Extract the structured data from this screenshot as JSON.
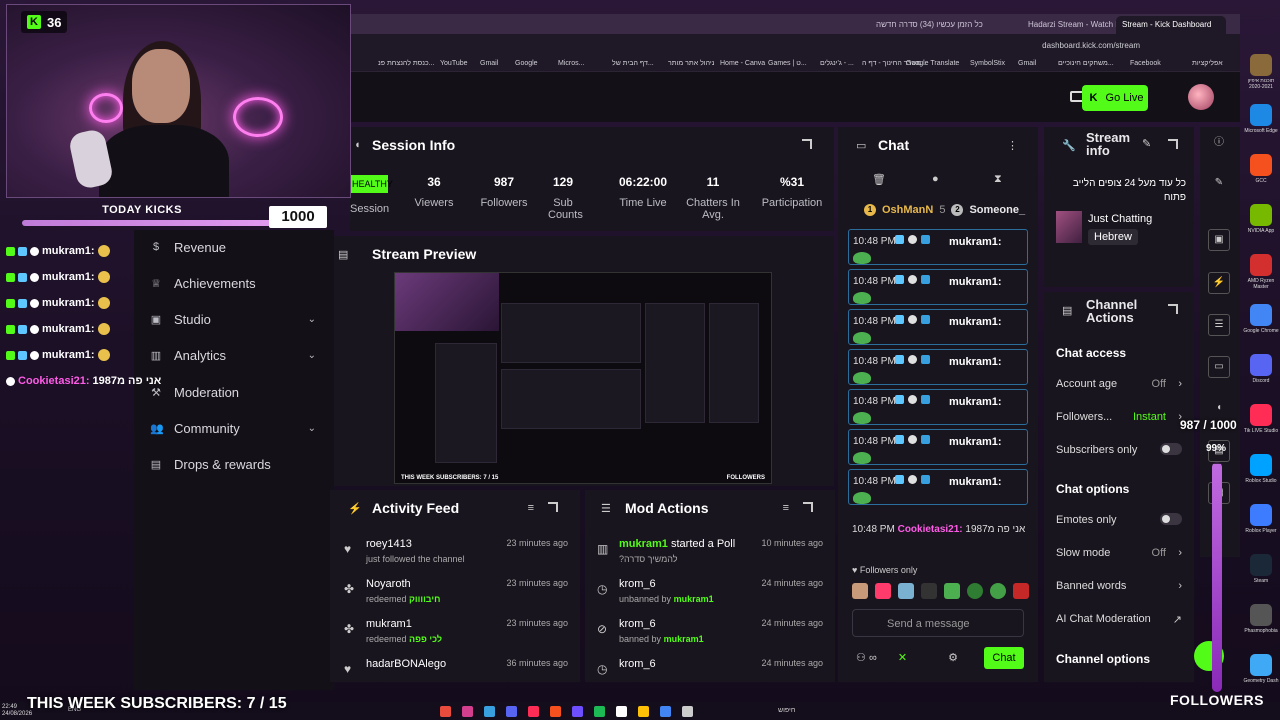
{
  "browser": {
    "tabs": [
      "כל הזמן עכשיו (34) סדרה חדשה",
      "Hadarzi Stream - Watch Live on...",
      "Stream - Kick Dashboard"
    ],
    "url": "dashboard.kick.com/stream",
    "bookmarks": [
      "כנסת להנצחת פנ...",
      "YouTube",
      "Gmail",
      "Google",
      "Micros...",
      "דף הבית של...",
      "ניהול אתר מותר",
      "Home - Canva",
      "Games | ט...",
      "ג'ינגלים - ...",
      "משרד החינוך - דף ה...",
      "Google Translate",
      "SymbolStix",
      "Gmail",
      "משחקים חינוכיים...",
      "Facebook",
      "אפליקציות"
    ]
  },
  "webcam": {
    "viewer_count": "36"
  },
  "kicks": {
    "label": "TODAY KICKS",
    "value": "1000",
    "progress": 1.0
  },
  "overlay_chat": {
    "rows": [
      {
        "user": "mukram1:"
      },
      {
        "user": "mukram1:"
      },
      {
        "user": "mukram1:"
      },
      {
        "user": "mukram1:"
      },
      {
        "user": "mukram1:"
      }
    ],
    "last": {
      "user": "Cookietasi21:",
      "text": "אני פה מ1987"
    }
  },
  "sidebar": {
    "items": [
      {
        "label": "Revenue",
        "icon": "dollar-icon"
      },
      {
        "label": "Achievements",
        "icon": "trophy-icon"
      },
      {
        "label": "Studio",
        "icon": "studio-icon"
      },
      {
        "label": "Analytics",
        "icon": "analytics-icon"
      },
      {
        "label": "Moderation",
        "icon": "gavel-icon"
      },
      {
        "label": "Community",
        "icon": "people-icon"
      },
      {
        "label": "Drops & rewards",
        "icon": "gift-icon"
      }
    ]
  },
  "appbar": {
    "go_live": "Go Live"
  },
  "session": {
    "title": "Session Info",
    "healthy": "HEALTHY",
    "session_label": "Session",
    "stats": [
      {
        "value": "36",
        "label": "Viewers"
      },
      {
        "value": "987",
        "label": "Followers"
      },
      {
        "value": "129",
        "label": "Sub Counts"
      },
      {
        "value": "06:22:00",
        "label": "Time Live"
      },
      {
        "value": "11",
        "label": "Chatters In Avg."
      },
      {
        "value": "%31",
        "label": "Participation"
      }
    ]
  },
  "preview": {
    "title": "Stream Preview",
    "subs_text": "THIS WEEK SUBSCRIBERS: 7 / 15",
    "followers_text": "FOLLOWERS"
  },
  "activity": {
    "title": "Activity Feed",
    "rows": [
      {
        "user": "roey1413",
        "sub": "just followed the channel",
        "highlight": "",
        "time": "23 minutes ago",
        "icon": "heart-icon"
      },
      {
        "user": "Noyaroth",
        "sub": "redeemed",
        "highlight": "חיבווווק",
        "time": "23 minutes ago",
        "icon": "redeem-icon"
      },
      {
        "user": "mukram1",
        "sub": "redeemed",
        "highlight": "לכי פפה",
        "time": "23 minutes ago",
        "icon": "redeem-icon"
      },
      {
        "user": "hadarBONAlego",
        "sub": "",
        "highlight": "",
        "time": "36 minutes ago",
        "icon": "heart-icon"
      }
    ]
  },
  "modactions": {
    "title": "Mod Actions",
    "rows": [
      {
        "user": "mukram1",
        "action": "started a Poll",
        "sub": "?להמשיך סדרה",
        "by": "",
        "time": "10 minutes ago",
        "icon": "poll-icon"
      },
      {
        "user": "krom_6",
        "action": "",
        "sub": "unbanned by",
        "by": "mukram1",
        "time": "24 minutes ago",
        "icon": "clock-icon"
      },
      {
        "user": "krom_6",
        "action": "",
        "sub": "banned by",
        "by": "mukram1",
        "time": "24 minutes ago",
        "icon": "ban-icon"
      },
      {
        "user": "krom_6",
        "action": "",
        "sub": "",
        "by": "",
        "time": "24 minutes ago",
        "icon": "clock-icon"
      }
    ]
  },
  "chat": {
    "title": "Chat",
    "pinned": [
      {
        "rank": "1",
        "user": "OshManN",
        "count": "5"
      },
      {
        "rank": "2",
        "user": "Someone_"
      }
    ],
    "messages": [
      {
        "time": "10:48 PM",
        "user": "mukram1:"
      },
      {
        "time": "10:48 PM",
        "user": "mukram1:"
      },
      {
        "time": "10:48 PM",
        "user": "mukram1:"
      },
      {
        "time": "10:48 PM",
        "user": "mukram1:"
      },
      {
        "time": "10:48 PM",
        "user": "mukram1:"
      },
      {
        "time": "10:48 PM",
        "user": "mukram1:"
      },
      {
        "time": "10:48 PM",
        "user": "mukram1:"
      }
    ],
    "last_time": "10:48 PM",
    "last_user": "Cookietasi21:",
    "last_text": "אני פה מ1987",
    "followers_only": "Followers only",
    "placeholder": "Send a message",
    "send_label": "Chat"
  },
  "stream_info": {
    "title": "Stream info",
    "description": "כל עוד מעל 24 צופים הלייב פתוח",
    "category": "Just Chatting",
    "language": "Hebrew"
  },
  "channel_actions": {
    "title": "Channel Actions",
    "chat_access": "Chat access",
    "account_age": {
      "label": "Account age",
      "value": "Off"
    },
    "followers": {
      "label": "Followers...",
      "value": "Instant"
    },
    "subscribers_only": {
      "label": "Subscribers only"
    },
    "chat_options": "Chat options",
    "emotes_only": {
      "label": "Emotes only"
    },
    "slow_mode": {
      "label": "Slow mode",
      "value": "Off"
    },
    "banned_words": {
      "label": "Banned words"
    },
    "ai_moderation": {
      "label": "AI Chat Moderation"
    },
    "channel_options": "Channel options"
  },
  "overlay": {
    "follow_goal": "987 / 1000",
    "follow_pct": "99%",
    "follow_progress": 0.99,
    "week_subs": "THIS WEEK SUBSCRIBERS: 7 / 15",
    "followers_label": "FOLLOWERS"
  },
  "desktop_icons": [
    {
      "label": "תוכנות איפיון 2020-2021"
    },
    {
      "label": "Microsoft Edge"
    },
    {
      "label": "GCC"
    },
    {
      "label": "NVIDIA App"
    },
    {
      "label": "AMD Ryzen Master"
    },
    {
      "label": "Google Chrome"
    },
    {
      "label": "Discord"
    },
    {
      "label": "Tik LIVE Studio"
    },
    {
      "label": "Roblox Studio"
    },
    {
      "label": "Roblox Player"
    },
    {
      "label": "Steam"
    },
    {
      "label": "Phasmophobia"
    },
    {
      "label": "Geometry Dash"
    }
  ],
  "taskbar": {
    "time": "22:49",
    "date": "24/08/2026",
    "lang": "ENG",
    "search": "חיפוש"
  }
}
